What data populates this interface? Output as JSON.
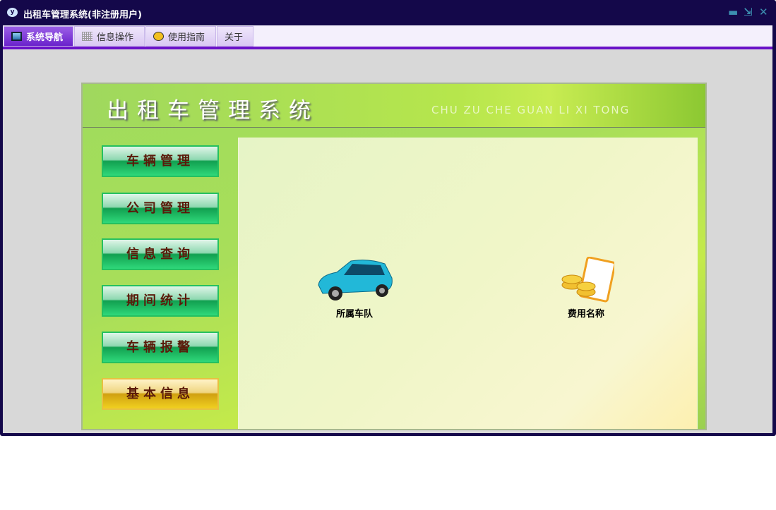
{
  "window": {
    "title": "出租车管理系统(非注册用户)",
    "logo": "y"
  },
  "controls": {
    "minimize": "▬",
    "restore": "⇲",
    "close": "✕"
  },
  "tabs": [
    {
      "label": "系统导航",
      "icon": "monitor-icon"
    },
    {
      "label": "信息操作",
      "icon": "grid-icon"
    },
    {
      "label": "使用指南",
      "icon": "help-icon"
    },
    {
      "label": "关于"
    }
  ],
  "header": {
    "title": "出租车管理系统",
    "subtitle": "CHU ZU CHE GUAN LI XI TONG"
  },
  "menu": [
    "车辆管理",
    "公司管理",
    "信息查询",
    "期间统计",
    "车辆报警",
    "基本信息"
  ],
  "items": [
    {
      "label": "所属车队",
      "icon": "car-icon"
    },
    {
      "label": "费用名称",
      "icon": "coins-icon"
    }
  ]
}
